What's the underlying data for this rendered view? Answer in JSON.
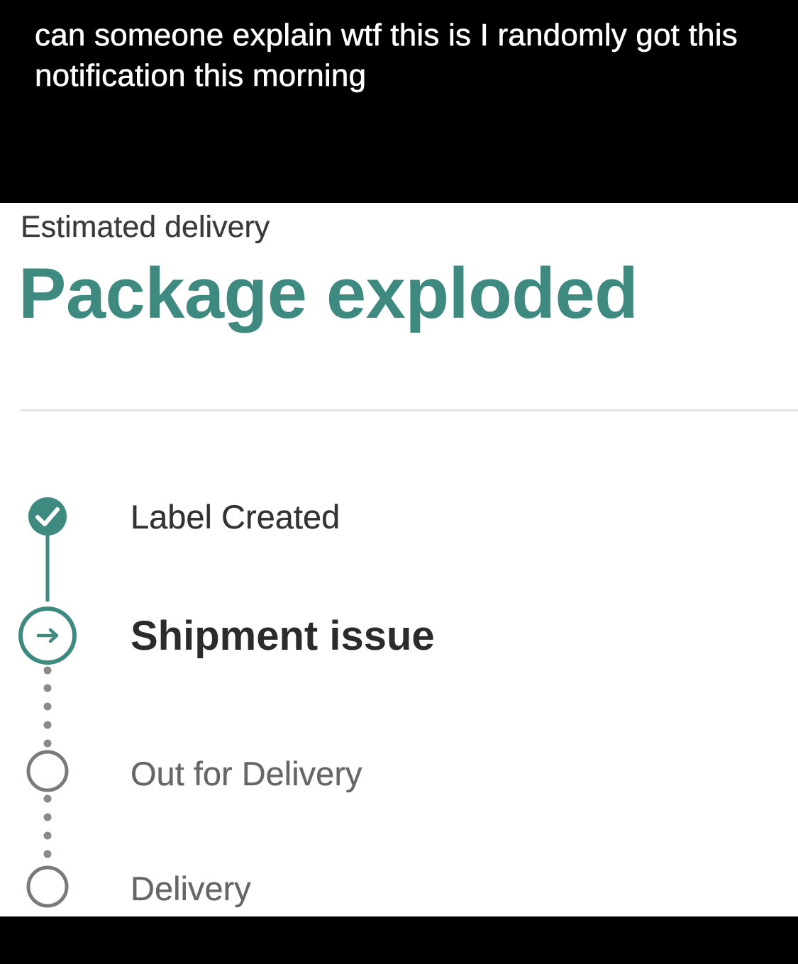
{
  "post": {
    "caption": "can someone explain wtf this is I randomly got this notification this morning"
  },
  "tracking": {
    "estimated_label": "Estimated delivery",
    "status_title": "Package exploded",
    "accent_color": "#3f8a80",
    "steps": [
      {
        "label": "Label Created",
        "state": "done",
        "icon": "check-circle-icon"
      },
      {
        "label": "Shipment issue",
        "state": "current",
        "icon": "arrow-circle-icon"
      },
      {
        "label": "Out for Delivery",
        "state": "pending",
        "icon": "empty-circle-icon"
      },
      {
        "label": "Delivery",
        "state": "pending",
        "icon": "empty-circle-icon"
      }
    ]
  }
}
